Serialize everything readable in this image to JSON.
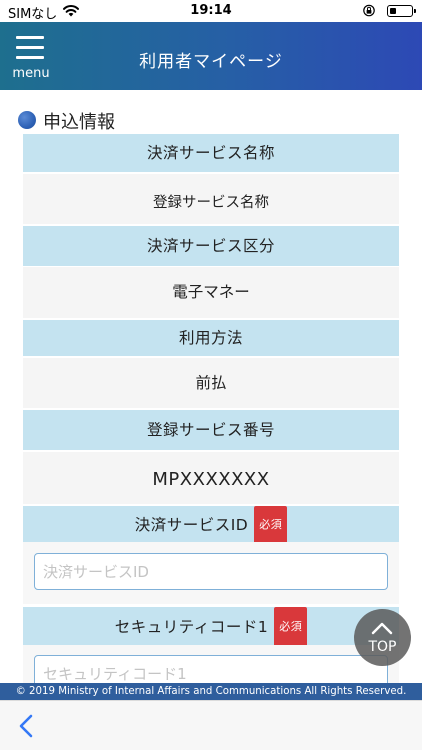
{
  "status_bar": {
    "carrier": "SIMなし",
    "time": "19:14"
  },
  "header": {
    "menu_label": "menu",
    "title": "利用者マイページ"
  },
  "section": {
    "title": "申込情報"
  },
  "rows": [
    {
      "label": "決済サービス名称",
      "value": "登録サービス名称"
    },
    {
      "label": "決済サービス区分",
      "value": "電子マネー"
    },
    {
      "label": "利用方法",
      "value": "前払"
    },
    {
      "label": "登録サービス番号",
      "value": "MPXXXXXXX"
    }
  ],
  "inputs": [
    {
      "label": "決済サービスID",
      "required": "必須",
      "placeholder": "決済サービスID",
      "value": ""
    },
    {
      "label": "セキュリティコード1",
      "required": "必須",
      "placeholder": "セキュリティコード1",
      "value": ""
    }
  ],
  "top_button": {
    "label": "TOP"
  },
  "footer": {
    "copyright": "© 2019 Ministry of Internal Affairs and Communications All Rights Reserved."
  },
  "colors": {
    "header_start": "#1e6f8e",
    "header_end": "#2d49b5",
    "label_bg": "#c4e3f0",
    "value_bg": "#f5f5f5",
    "required_badge": "#d9383b",
    "footer_bg": "#2f5e9d",
    "back_arrow": "#3478f6"
  },
  "icons": {
    "wifi": "wifi-icon",
    "rotation_lock": "rotation-lock-icon",
    "battery": "battery-icon",
    "menu": "hamburger-icon",
    "section": "section-dot-icon",
    "top": "chevron-up-icon",
    "back": "chevron-left-icon"
  }
}
